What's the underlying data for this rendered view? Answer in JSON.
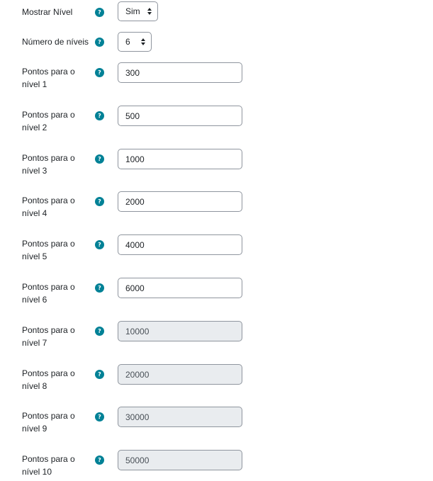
{
  "show_level": {
    "label": "Mostrar Nível",
    "value": "Sim"
  },
  "num_levels": {
    "label": "Número de níveis",
    "value": "6"
  },
  "help_glyph": "?",
  "icons": {
    "help": "question-circle-icon",
    "select_arrows": "sort-arrows-icon"
  },
  "colors": {
    "help_icon": "#008196",
    "disabled_field": "#e9ecef",
    "border": "#8f959e"
  },
  "levels": [
    {
      "label_line1": "Pontos para o",
      "label_line2": "nível 1",
      "value": "300",
      "enabled": true
    },
    {
      "label_line1": "Pontos para o",
      "label_line2": "nível 2",
      "value": "500",
      "enabled": true
    },
    {
      "label_line1": "Pontos para o",
      "label_line2": "nível 3",
      "value": "1000",
      "enabled": true
    },
    {
      "label_line1": "Pontos para o",
      "label_line2": "nível 4",
      "value": "2000",
      "enabled": true
    },
    {
      "label_line1": "Pontos para o",
      "label_line2": "nível 5",
      "value": "4000",
      "enabled": true
    },
    {
      "label_line1": "Pontos para o",
      "label_line2": "nível 6",
      "value": "6000",
      "enabled": true
    },
    {
      "label_line1": "Pontos para o",
      "label_line2": "nível 7",
      "value": "10000",
      "enabled": false
    },
    {
      "label_line1": "Pontos para o",
      "label_line2": "nível 8",
      "value": "20000",
      "enabled": false
    },
    {
      "label_line1": "Pontos para o",
      "label_line2": "nível 9",
      "value": "30000",
      "enabled": false
    },
    {
      "label_line1": "Pontos para o",
      "label_line2": "nível 10",
      "value": "50000",
      "enabled": false
    }
  ]
}
